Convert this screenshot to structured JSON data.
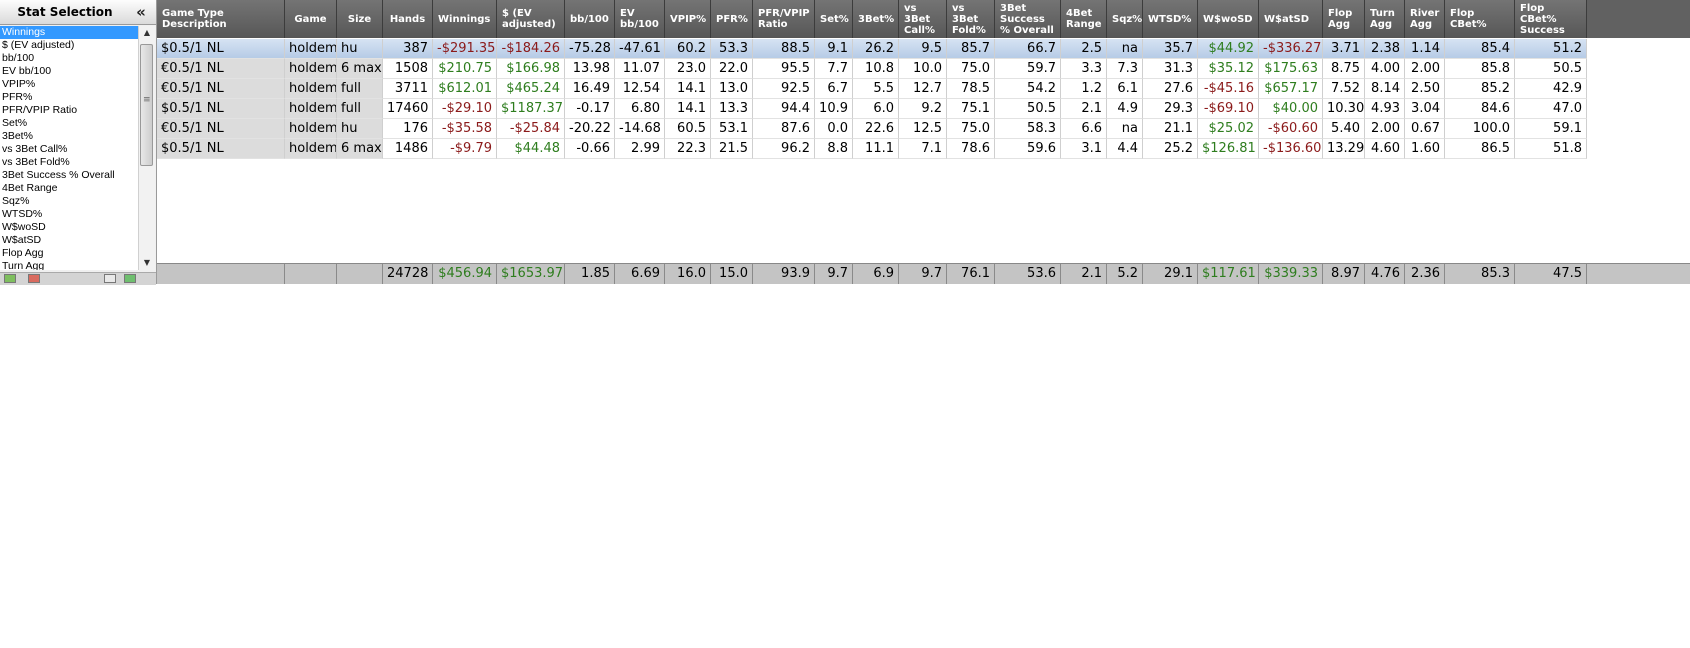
{
  "left_panel": {
    "title": "Stat Selection",
    "collapse_glyph": "«",
    "items": [
      "Winnings",
      "$ (EV adjusted)",
      "bb/100",
      "EV bb/100",
      "VPIP%",
      "PFR%",
      "PFR/VPIP Ratio",
      "Set%",
      "3Bet%",
      "vs 3Bet Call%",
      "vs 3Bet Fold%",
      "3Bet Success % Overall",
      "4Bet Range",
      "Sqz%",
      "WTSD%",
      "W$woSD",
      "W$atSD",
      "Flop Agg",
      "Turn Agg"
    ],
    "selected_index": 0
  },
  "table": {
    "columns": [
      "Game Type Description",
      "Game",
      "Size",
      "Hands",
      "Winnings",
      "$ (EV adjusted)",
      "bb/100",
      "EV bb/100",
      "VPIP%",
      "PFR%",
      "PFR/VPIP Ratio",
      "Set%",
      "3Bet%",
      "vs 3Bet Call%",
      "vs 3Bet Fold%",
      "3Bet Success % Overall",
      "4Bet Range",
      "Sqz%",
      "WTSD%",
      "W$woSD",
      "W$atSD",
      "Flop Agg",
      "Turn Agg",
      "River Agg",
      "Flop CBet%",
      "Flop CBet% Success"
    ],
    "rows": [
      [
        "$0.5/1 NL",
        "holdem",
        "hu",
        "387",
        "-$291.35",
        "-$184.26",
        "-75.28",
        "-47.61",
        "60.2",
        "53.3",
        "88.5",
        "9.1",
        "26.2",
        "9.5",
        "85.7",
        "66.7",
        "2.5",
        "na",
        "35.7",
        "$44.92",
        "-$336.27",
        "3.71",
        "2.38",
        "1.14",
        "85.4",
        "51.2"
      ],
      [
        "€0.5/1 NL",
        "holdem",
        "6 max",
        "1508",
        "$210.75",
        "$166.98",
        "13.98",
        "11.07",
        "23.0",
        "22.0",
        "95.5",
        "7.7",
        "10.8",
        "10.0",
        "75.0",
        "59.7",
        "3.3",
        "7.3",
        "31.3",
        "$35.12",
        "$175.63",
        "8.75",
        "4.00",
        "2.00",
        "85.8",
        "50.5"
      ],
      [
        "€0.5/1 NL",
        "holdem",
        "full",
        "3711",
        "$612.01",
        "$465.24",
        "16.49",
        "12.54",
        "14.1",
        "13.0",
        "92.5",
        "6.7",
        "5.5",
        "12.7",
        "78.5",
        "54.2",
        "1.2",
        "6.1",
        "27.6",
        "-$45.16",
        "$657.17",
        "7.52",
        "8.14",
        "2.50",
        "85.2",
        "42.9"
      ],
      [
        "$0.5/1 NL",
        "holdem",
        "full",
        "17460",
        "-$29.10",
        "$1187.37",
        "-0.17",
        "6.80",
        "14.1",
        "13.3",
        "94.4",
        "10.9",
        "6.0",
        "9.2",
        "75.1",
        "50.5",
        "2.1",
        "4.9",
        "29.3",
        "-$69.10",
        "$40.00",
        "10.30",
        "4.93",
        "3.04",
        "84.6",
        "47.0"
      ],
      [
        "€0.5/1 NL",
        "holdem",
        "hu",
        "176",
        "-$35.58",
        "-$25.84",
        "-20.22",
        "-14.68",
        "60.5",
        "53.1",
        "87.6",
        "0.0",
        "22.6",
        "12.5",
        "75.0",
        "58.3",
        "6.6",
        "na",
        "21.1",
        "$25.02",
        "-$60.60",
        "5.40",
        "2.00",
        "0.67",
        "100.0",
        "59.1"
      ],
      [
        "$0.5/1 NL",
        "holdem",
        "6 max",
        "1486",
        "-$9.79",
        "$44.48",
        "-0.66",
        "2.99",
        "22.3",
        "21.5",
        "96.2",
        "8.8",
        "11.1",
        "7.1",
        "78.6",
        "59.6",
        "3.1",
        "4.4",
        "25.2",
        "$126.81",
        "-$136.60",
        "13.29",
        "4.60",
        "1.60",
        "86.5",
        "51.8"
      ]
    ],
    "selected_row": 0,
    "totals": [
      "",
      "",
      "",
      "24728",
      "$456.94",
      "$1653.97",
      "1.85",
      "6.69",
      "16.0",
      "15.0",
      "93.9",
      "9.7",
      "6.9",
      "9.7",
      "76.1",
      "53.6",
      "2.1",
      "5.2",
      "29.1",
      "$117.61",
      "$339.33",
      "8.97",
      "4.76",
      "2.36",
      "85.3",
      "47.5"
    ],
    "colors": {
      "positive": "#2e7d1e",
      "negative": "#8b1a1a",
      "header_bg": "#616161",
      "selected_row": "#c7d7ed"
    }
  }
}
